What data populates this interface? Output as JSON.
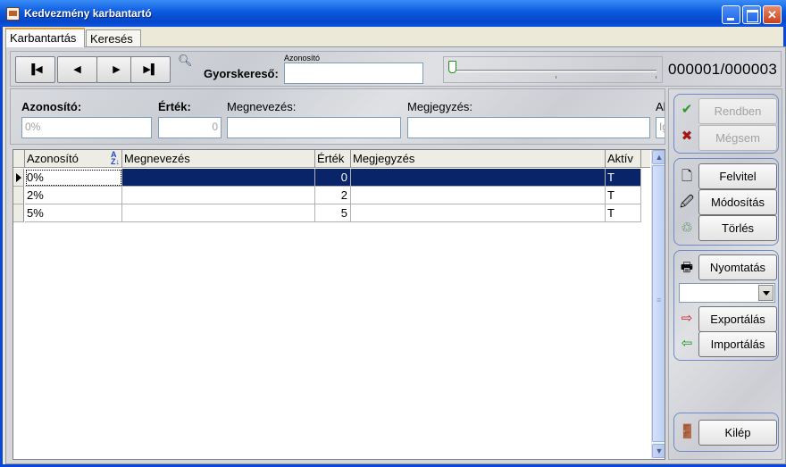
{
  "window": {
    "title": "Kedvezmény karbantartó"
  },
  "tabs": [
    {
      "label": "Karbantartás",
      "active": true
    },
    {
      "label": "Keresés",
      "active": false
    }
  ],
  "navigation": {
    "first_icon": "first-record-icon",
    "prev_icon": "previous-record-icon",
    "next_icon": "next-record-icon",
    "last_icon": "last-record-icon"
  },
  "quicksearch": {
    "caption": "Azonosító",
    "label": "Gyorskereső:",
    "value": ""
  },
  "slider": {
    "position": 0
  },
  "record_counter": "000001/000003",
  "fields": {
    "azonosito": {
      "label": "Azonosító:",
      "value": "0%"
    },
    "ertek": {
      "label": "Érték:",
      "value": "0"
    },
    "megnevezes": {
      "label": "Megnevezés:",
      "value": ""
    },
    "megjegyzes": {
      "label": "Megjegyzés:",
      "value": ""
    },
    "aktiv_partial": {
      "label": "Al",
      "value": "Ig"
    }
  },
  "grid": {
    "columns": [
      "Azonosító",
      "Megnevezés",
      "Érték",
      "Megjegyzés",
      "Aktív"
    ],
    "rows": [
      {
        "azonosito": "0%",
        "megnevezes": "",
        "ertek": "0",
        "megjegyzes": "",
        "aktiv": "T"
      },
      {
        "azonosito": "2%",
        "megnevezes": "",
        "ertek": "2",
        "megjegyzes": "",
        "aktiv": "T"
      },
      {
        "azonosito": "5%",
        "megnevezes": "",
        "ertek": "5",
        "megjegyzes": "",
        "aktiv": "T"
      }
    ],
    "selected_row": 0
  },
  "sidebar": {
    "ok": "Rendben",
    "cancel": "Mégsem",
    "add": "Felvitel",
    "modify": "Módosítás",
    "delete": "Törlés",
    "print": "Nyomtatás",
    "print_combo_value": "",
    "export": "Exportálás",
    "import": "Importálás",
    "exit": "Kilép"
  },
  "colors": {
    "titlebar": "#0a5ae0",
    "selection": "#0a246a",
    "ok_check": "#2a9a2a",
    "cancel_x": "#a01818"
  }
}
